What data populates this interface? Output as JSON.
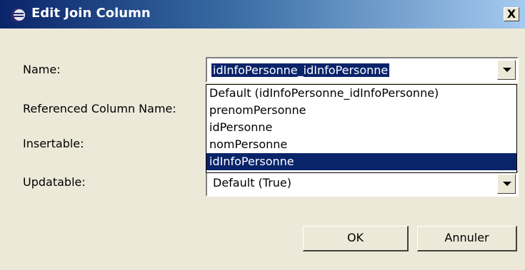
{
  "window": {
    "title": "Edit Join Column",
    "close_glyph": "X"
  },
  "form": {
    "name_label": "Name:",
    "name_value": "idInfoPersonne_idInfoPersonne",
    "referenced_label": "Referenced Column Name:",
    "insertable_label": "Insertable:",
    "updatable_label": "Updatable:",
    "updatable_value": "Default (True)"
  },
  "dropdown": {
    "items": [
      "Default (idInfoPersonne_idInfoPersonne)",
      "prenomPersonne",
      "idPersonne",
      "nomPersonne",
      "idInfoPersonne"
    ],
    "highlighted_index": 4
  },
  "buttons": {
    "ok": "OK",
    "cancel": "Annuler"
  },
  "colors": {
    "selection": "#0a246a",
    "dialog_bg": "#ece9d8"
  }
}
